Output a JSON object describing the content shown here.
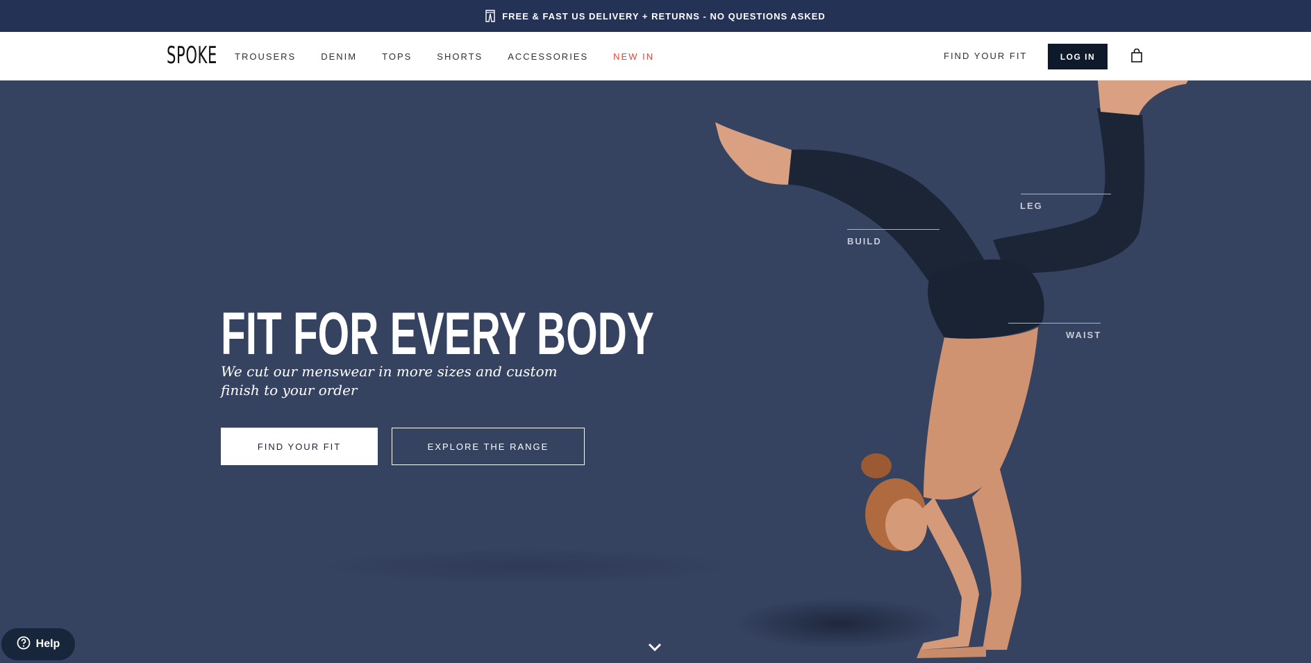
{
  "announcement": {
    "text": "FREE & FAST US DELIVERY + RETURNS - NO QUESTIONS ASKED",
    "icon": "trousers-icon"
  },
  "nav": {
    "logo": "SPOKE",
    "links": [
      "TROUSERS",
      "DENIM",
      "TOPS",
      "SHORTS",
      "ACCESSORIES",
      "NEW IN"
    ],
    "find_fit": "FIND YOUR FIT",
    "login": "LOG IN",
    "cart_icon": "shopping-bag-icon"
  },
  "hero": {
    "title": "FIT FOR EVERY BODY",
    "subtitle": "We cut our menswear in more sizes and custom finish to your order",
    "primary_button": "FIND YOUR FIT",
    "secondary_button": "EXPLORE THE RANGE",
    "labels": {
      "build": "BUILD",
      "leg": "LEG",
      "waist": "WAIST"
    },
    "scroll_icon": "chevron-down-icon"
  },
  "help": {
    "label": "Help",
    "icon": "question-circle-icon"
  },
  "colors": {
    "announcement_bg": "#243255",
    "hero_bg": "#354260",
    "login_bg": "#0e1a2b",
    "new_in": "#e0453a",
    "help_bg": "#17263a"
  }
}
